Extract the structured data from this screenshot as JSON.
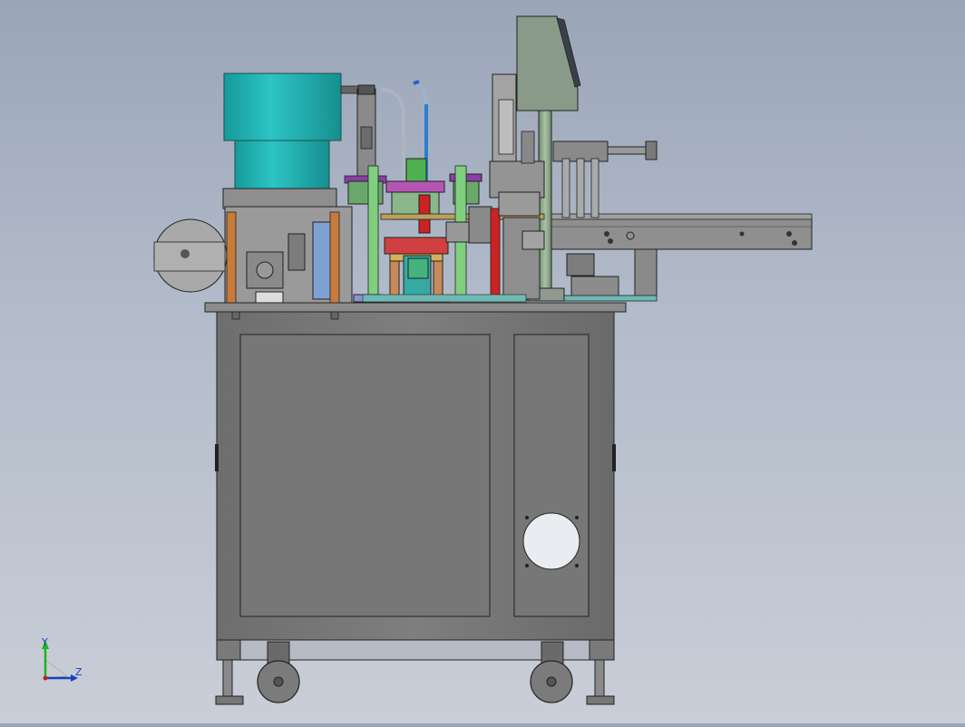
{
  "viewport": {
    "background_top": "#9aa5b8",
    "background_bottom": "#c9ced8"
  },
  "triad": {
    "y_label": "Y",
    "z_label": "Z",
    "y_color": "#1db31d",
    "z_color": "#1a3fbf",
    "x_color": "#d01a1a"
  },
  "colors": {
    "cabinet": "#7a7a7a",
    "cabinet_dark": "#5e5e5e",
    "bowl_feeder": "#23b2b2",
    "conveyor": "#8f8f8f",
    "hmi_panel": "#8a9a88",
    "cylinder_green": "#7fcf7f",
    "cylinder_orange": "#c87a3a",
    "cylinder_red": "#cc2222",
    "accent_purple": "#8a3ea6",
    "accent_blue": "#2a5fd0"
  }
}
